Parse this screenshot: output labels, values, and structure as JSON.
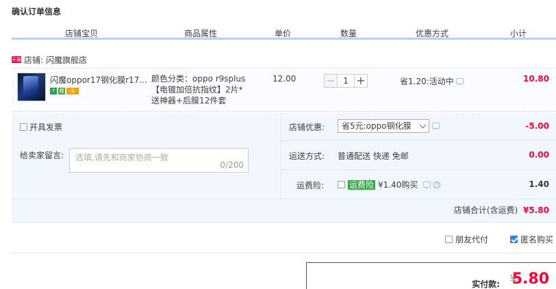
{
  "page_title": "确认订单信息",
  "table_headers": [
    "店铺宝贝",
    "商品属性",
    "单价",
    "数量",
    "优惠方式",
    "小计"
  ],
  "shop": {
    "badge_text": "天猫",
    "label": "店铺:",
    "name": "闪魔旗舰店"
  },
  "item": {
    "title": "闪魔oppor17钢化膜r17...",
    "badges": [
      "7",
      "赠",
      "卡"
    ],
    "props_line1": "颜色分类：oppo r9splus",
    "props_line2": "【电镀加倍抗指纹】2片*",
    "props_line3": "送神器+后膜12件套",
    "price": "12.00",
    "qty_minus": "−",
    "qty_value": "1",
    "qty_plus": "+",
    "promo": "省1.20:活动中",
    "subtotal": "10.80"
  },
  "panel": {
    "invoice_label": "开具发票",
    "message_label": "给卖家留言:",
    "message_placeholder": "选填,请先和商家协商一致",
    "message_count": "0/200",
    "discount_label": "店铺优惠:",
    "discount_select": "省5元:oppo钢化膜",
    "discount_value": "-5.00",
    "shipping_label": "运送方式:",
    "shipping_method": "普通配送 快递 免邮",
    "shipping_value": "0.00",
    "insurance_label": "运费险:",
    "insurance_tag": "运费险",
    "insurance_text": "¥1.40购买",
    "insurance_value": "1.40",
    "shop_total_label": "店铺合计(含运费)",
    "shop_total_value": "¥5.80"
  },
  "options": {
    "friend_pay": "朋友代付",
    "anonymous": "匿名购买"
  },
  "payment": {
    "label": "实付款:",
    "currency": "¥",
    "amount": "5.80"
  },
  "colors": {
    "accent_red": "#ff0036",
    "header_line": "#b2d1ff",
    "panel_bg": "#f2f7ff",
    "checkbox_blue": "#3c80e6",
    "insurance_green": "#2fab43"
  }
}
